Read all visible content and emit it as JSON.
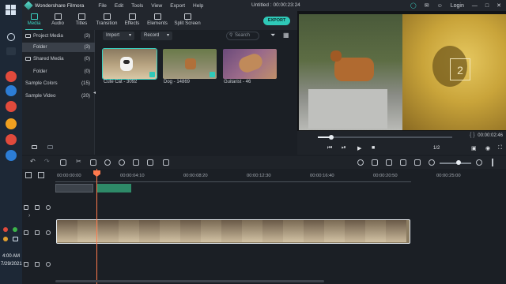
{
  "taskbar": {
    "time": "4:00 AM",
    "date": "7/29/2021"
  },
  "app": {
    "name": "Wondershare Filmora",
    "menu": [
      "File",
      "Edit",
      "Tools",
      "View",
      "Export",
      "Help"
    ],
    "document_title": "Untitled : 00:00:23:24",
    "login_label": "Login"
  },
  "tabs": [
    {
      "label": "Media",
      "active": true
    },
    {
      "label": "Audio"
    },
    {
      "label": "Titles"
    },
    {
      "label": "Transition"
    },
    {
      "label": "Effects"
    },
    {
      "label": "Elements"
    },
    {
      "label": "Split Screen"
    }
  ],
  "export_label": "EXPORT",
  "tree": {
    "project_media": {
      "label": "Project Media",
      "count": "(3)"
    },
    "project_folder": {
      "label": "Folder",
      "count": "(3)"
    },
    "shared_media": {
      "label": "Shared Media",
      "count": "(0)"
    },
    "shared_folder": {
      "label": "Folder",
      "count": "(0)"
    },
    "sample_colors": {
      "label": "Sample Colors",
      "count": "(15)"
    },
    "sample_video": {
      "label": "Sample Video",
      "count": "(20)"
    }
  },
  "mediabar": {
    "import_label": "Import",
    "record_label": "Record",
    "search_placeholder": "Search"
  },
  "media_items": [
    {
      "label": "Cute Cat - 3092",
      "selected": true
    },
    {
      "label": "Dog - 14869"
    },
    {
      "label": "Guitarist - 46"
    }
  ],
  "preview": {
    "timecode": "00:00:02:46",
    "ratio": "1/2"
  },
  "ruler_labels": [
    "00:00:00:00",
    "00:00:04:10",
    "00:00:08:20",
    "00:00:12:30",
    "00:00:16:40",
    "00:00:20:50",
    "00:00:25:00"
  ],
  "colors": {
    "accent": "#3bd1c0",
    "playhead": "#ff7a4d",
    "marker": "#2e8a68"
  }
}
